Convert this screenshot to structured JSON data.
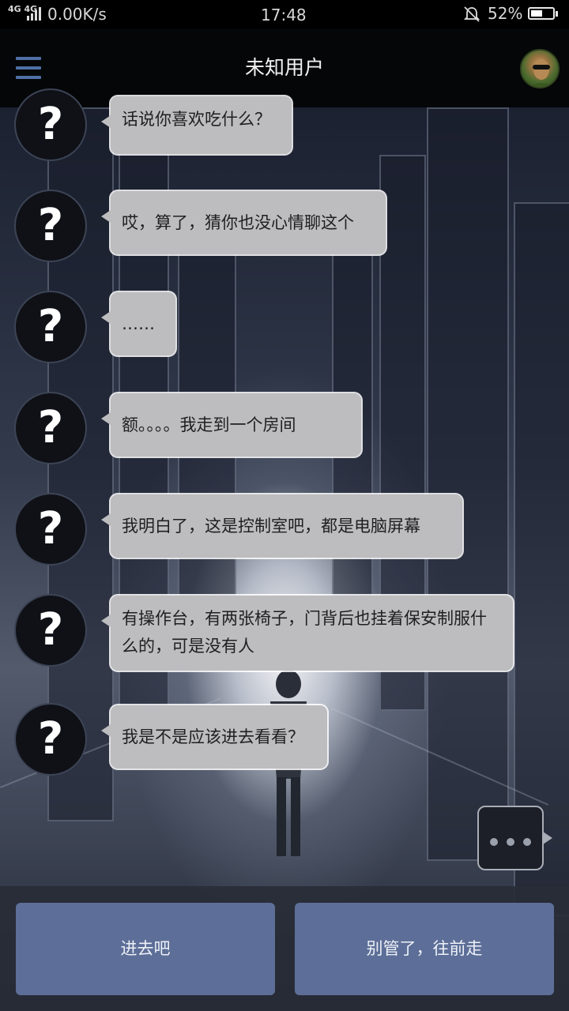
{
  "status_bar": {
    "network": "4G 4G",
    "speed": "0.00K/s",
    "time": "17:48",
    "battery": "52%",
    "battery_level": 0.52,
    "icons": [
      "signal-icon",
      "mute-bell-icon",
      "battery-icon"
    ]
  },
  "header": {
    "title": "未知用户",
    "icons": [
      "menu-icon",
      "avatar"
    ]
  },
  "messages": [
    {
      "avatar": "?",
      "text": "话说你喜欢吃什么？"
    },
    {
      "avatar": "?",
      "text": "哎，算了，猜你也没心情聊这个"
    },
    {
      "avatar": "?",
      "text": "……"
    },
    {
      "avatar": "?",
      "text": "额。。。。我走到一个房间"
    },
    {
      "avatar": "?",
      "text": "我明白了，这是控制室吧，都是电脑屏幕"
    },
    {
      "avatar": "?",
      "text": "有操作台，有两张椅子，门背后也挂着保安制服什么的，可是没有人"
    },
    {
      "avatar": "?",
      "text": "我是不是应该进去看看？"
    }
  ],
  "typing_indicator": {
    "icon": "typing-dots-icon"
  },
  "choices": [
    {
      "label": "进去吧"
    },
    {
      "label": "别管了，往前走"
    }
  ],
  "colors": {
    "header_bg": "#050608",
    "menu_accent": "#4f6fa5",
    "bubble_bg": "#bdbdbf",
    "choice_bg": "#5d6f98"
  }
}
